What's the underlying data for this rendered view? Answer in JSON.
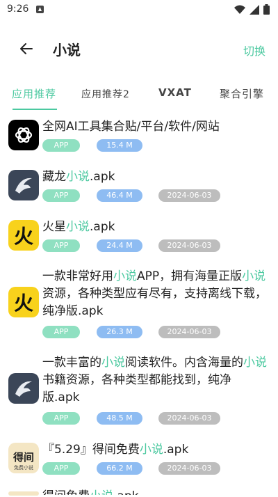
{
  "status": {
    "time": "9:26"
  },
  "appbar": {
    "title": "小说",
    "switch_label": "切换"
  },
  "tabs": [
    {
      "label": "应用推荐",
      "active": true
    },
    {
      "label": "应用推荐2",
      "active": false
    },
    {
      "label": "VXAT",
      "active": false
    },
    {
      "label": "聚合引擎",
      "active": false
    }
  ],
  "items": [
    {
      "icon": "openai-logo-icon",
      "title_parts": [
        "全网AI工具集合贴/平台/软件/网站"
      ],
      "tag": "APP",
      "size": "15.4 M",
      "date": ""
    },
    {
      "icon": "canglong-dragon-icon",
      "title_parts": [
        "藏龙",
        "小说",
        ".apk"
      ],
      "tag": "APP",
      "size": "46.4 M",
      "date": "2024-06-03"
    },
    {
      "icon": "huoxing-fire-icon",
      "title_parts": [
        "火星",
        "小说",
        ".apk"
      ],
      "tag": "APP",
      "size": "24.4 M",
      "date": "2024-06-03"
    },
    {
      "icon": "huoxing-fire-icon",
      "title_parts": [
        "一款非常好用",
        "小说",
        "APP，拥有海量正版",
        "小说",
        "资源，各种类型应有尽有，支持离线下载，纯净版.apk"
      ],
      "tag": "APP",
      "size": "26.3 M",
      "date": "2024-06-03"
    },
    {
      "icon": "canglong-dragon-icon",
      "title_parts": [
        "一款丰富的",
        "小说",
        "阅读软件。内含海量的",
        "小说",
        "书籍资源，各种类型都能找到，纯净版.apk"
      ],
      "tag": "APP",
      "size": "48.5 M",
      "date": "2024-06-03"
    },
    {
      "icon": "dejian-book-icon",
      "icon_text": "得间",
      "icon_subtext": "免费小说",
      "title_parts": [
        "『5.29』得间免费",
        "小说",
        ".apk"
      ],
      "tag": "APP",
      "size": "66.2 M",
      "date": "2024-06-03"
    },
    {
      "icon": "dejian-book-icon",
      "title_parts": [
        "得间免费",
        "小说",
        ".apk"
      ],
      "tag": "",
      "size": "",
      "date": ""
    }
  ],
  "colors": {
    "accent": "#4cc9a0",
    "app_badge": "#8fe0c1",
    "size_badge": "#8ebcf2",
    "date_badge": "#bdbdbd"
  }
}
